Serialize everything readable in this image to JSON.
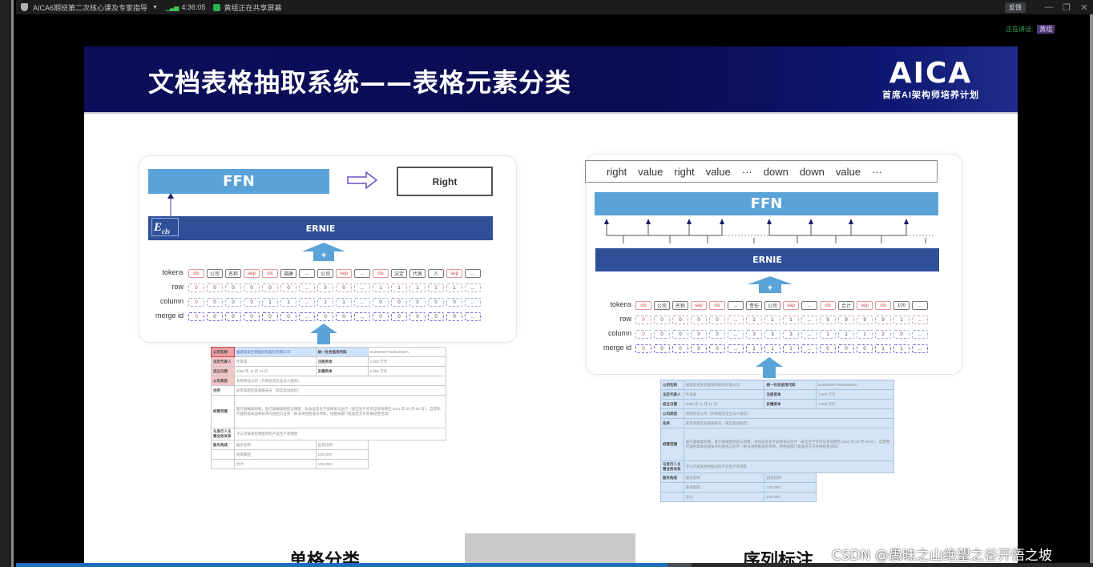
{
  "topbar": {
    "meeting_title": "AICA6期班第二次核心课及专家指导",
    "time": "4:36:05",
    "sharing_status": "黄组正在共享屏幕",
    "feedback_label": "反馈",
    "minimize_icon": "—",
    "restore_icon": "❐",
    "close_icon": "✕"
  },
  "speaking": {
    "label": "正在讲话:",
    "name": "黄组"
  },
  "slide": {
    "title": "文档表格抽取系统——表格元素分类",
    "logo_main": "AICA",
    "logo_sub": "首席AI架构师培养计划",
    "left_panel": {
      "ffn_label": "FFN",
      "output_label": "Right",
      "ernie_label": "ERNIE",
      "ecls_label": "E",
      "ecls_sub": "cls",
      "row_labels": [
        "tokens",
        "row",
        "column",
        "merge id"
      ],
      "tokens": [
        "cls",
        "公司",
        "名称",
        "sep",
        "cls",
        "福建",
        "...",
        "公司",
        "sep",
        "...",
        "cls",
        "法定",
        "代表",
        "人",
        "sep",
        "..."
      ],
      "row": [
        "0",
        "0",
        "0",
        "0",
        "0",
        "0",
        "...",
        "0",
        "0",
        "...",
        "1",
        "1",
        "1",
        "1",
        "1",
        "..."
      ],
      "column": [
        "0",
        "0",
        "0",
        "0",
        "1",
        "1",
        "...",
        "1",
        "1",
        "...",
        "0",
        "0",
        "0",
        "0",
        "0",
        "..."
      ],
      "merge_id": [
        "0",
        "0",
        "0",
        "0",
        "0",
        "0",
        "...",
        "0",
        "0",
        "...",
        "0",
        "0",
        "0",
        "0",
        "0",
        "..."
      ]
    },
    "right_panel": {
      "output_labels": [
        "right",
        "value",
        "right",
        "value",
        "···",
        "down",
        "down",
        "value",
        "···"
      ],
      "ffn_label": "FFN",
      "ernie_label": "ERNIE",
      "row_labels": [
        "tokens",
        "row",
        "column",
        "merge id"
      ],
      "tokens": [
        "cls",
        "公司",
        "名称",
        "sep",
        "cls",
        "...",
        "责任",
        "公司",
        "sep",
        "...",
        "cls",
        "合计",
        "sep",
        "cls",
        "100",
        "..."
      ],
      "row": [
        "0",
        "0",
        "0",
        "0",
        "0",
        "...",
        "1",
        "1",
        "1",
        "...",
        "9",
        "9",
        "9",
        "9",
        "1",
        "..."
      ],
      "column": [
        "0",
        "0",
        "0",
        "0",
        "0",
        "...",
        "3",
        "3",
        "3",
        "...",
        "1",
        "1",
        "1",
        "2",
        "0",
        "..."
      ],
      "merge_id": [
        "0",
        "0",
        "0",
        "0",
        "0",
        "...",
        "1",
        "1",
        "1",
        "...",
        "0",
        "0",
        "0",
        "1",
        "1",
        "..."
      ]
    },
    "doc_table": {
      "rows": [
        [
          "公司名称",
          "福建某某生物医材料股份有限公司",
          "统一社会信用代码",
          "91350000776405496XA"
        ],
        [
          "法定代表人",
          "叶某某",
          "注册资本",
          "1,000 万元"
        ],
        [
          "成立日期",
          "2006 年 11 月 13 日",
          "实缴资本",
          "1,000 万元"
        ],
        [
          "公司类型",
          "有限责任公司（外商投资企业法人独资）"
        ],
        [
          "住所",
          "某市某新区某某路某号（某自贸试验区）"
        ],
        [
          "经营范围",
          "医疗器械类研制，医疗器械类制造与销售；化妆品及化学品研发与生产（安全生产许可证有效期至 2021 年 02 月 08 日）；自营和代理各类商品和技术的进出口业务（依法须经批准的项目，经相关部门批准后方可开展经营活动）"
        ],
        [
          "与发行人主营业务关系",
          "子公司某某生物医材料产品生产及销售"
        ],
        [
          "股东构成",
          "股东名称",
          "出资比例"
        ],
        [
          "",
          "某某集团",
          "100.00%"
        ],
        [
          "",
          "合计",
          "100.00%"
        ]
      ]
    },
    "captions": {
      "left": "单格分类",
      "right": "序列标注"
    }
  },
  "playback": {
    "progress_fraction": 0.605,
    "buffered_fraction": 0.627
  },
  "watermark": "CSDN @愚昧之山绝望之谷开悟之坡"
}
